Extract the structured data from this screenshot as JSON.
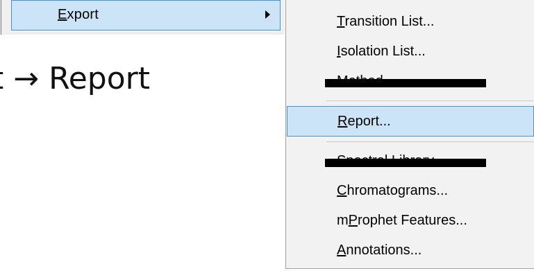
{
  "parent_menu": {
    "export_item": {
      "label_prefix": "",
      "accel": "E",
      "label_rest": "xport"
    }
  },
  "breadcrumb": {
    "text": "t → Report"
  },
  "submenu": {
    "items": [
      {
        "accel": "T",
        "rest": "ransition List...",
        "state": "normal"
      },
      {
        "accel": "I",
        "rest": "solation List...",
        "state": "normal"
      },
      {
        "peek": "Method...",
        "state": "redacted"
      },
      {
        "accel": "R",
        "rest": "eport...",
        "state": "highlighted"
      },
      {
        "peek": "Spectral Library...",
        "state": "redacted"
      },
      {
        "accel": "C",
        "rest": "hromatograms...",
        "state": "normal"
      },
      {
        "pre": "m",
        "accel": "P",
        "rest": "rophet Features...",
        "state": "normal"
      },
      {
        "accel": "A",
        "rest": "nnotations...",
        "state": "normal"
      }
    ]
  },
  "colors": {
    "highlight_bg": "#cce4f7",
    "highlight_border": "#4a90d9",
    "menu_bg": "#f2f2f2",
    "redaction": "#000000"
  }
}
